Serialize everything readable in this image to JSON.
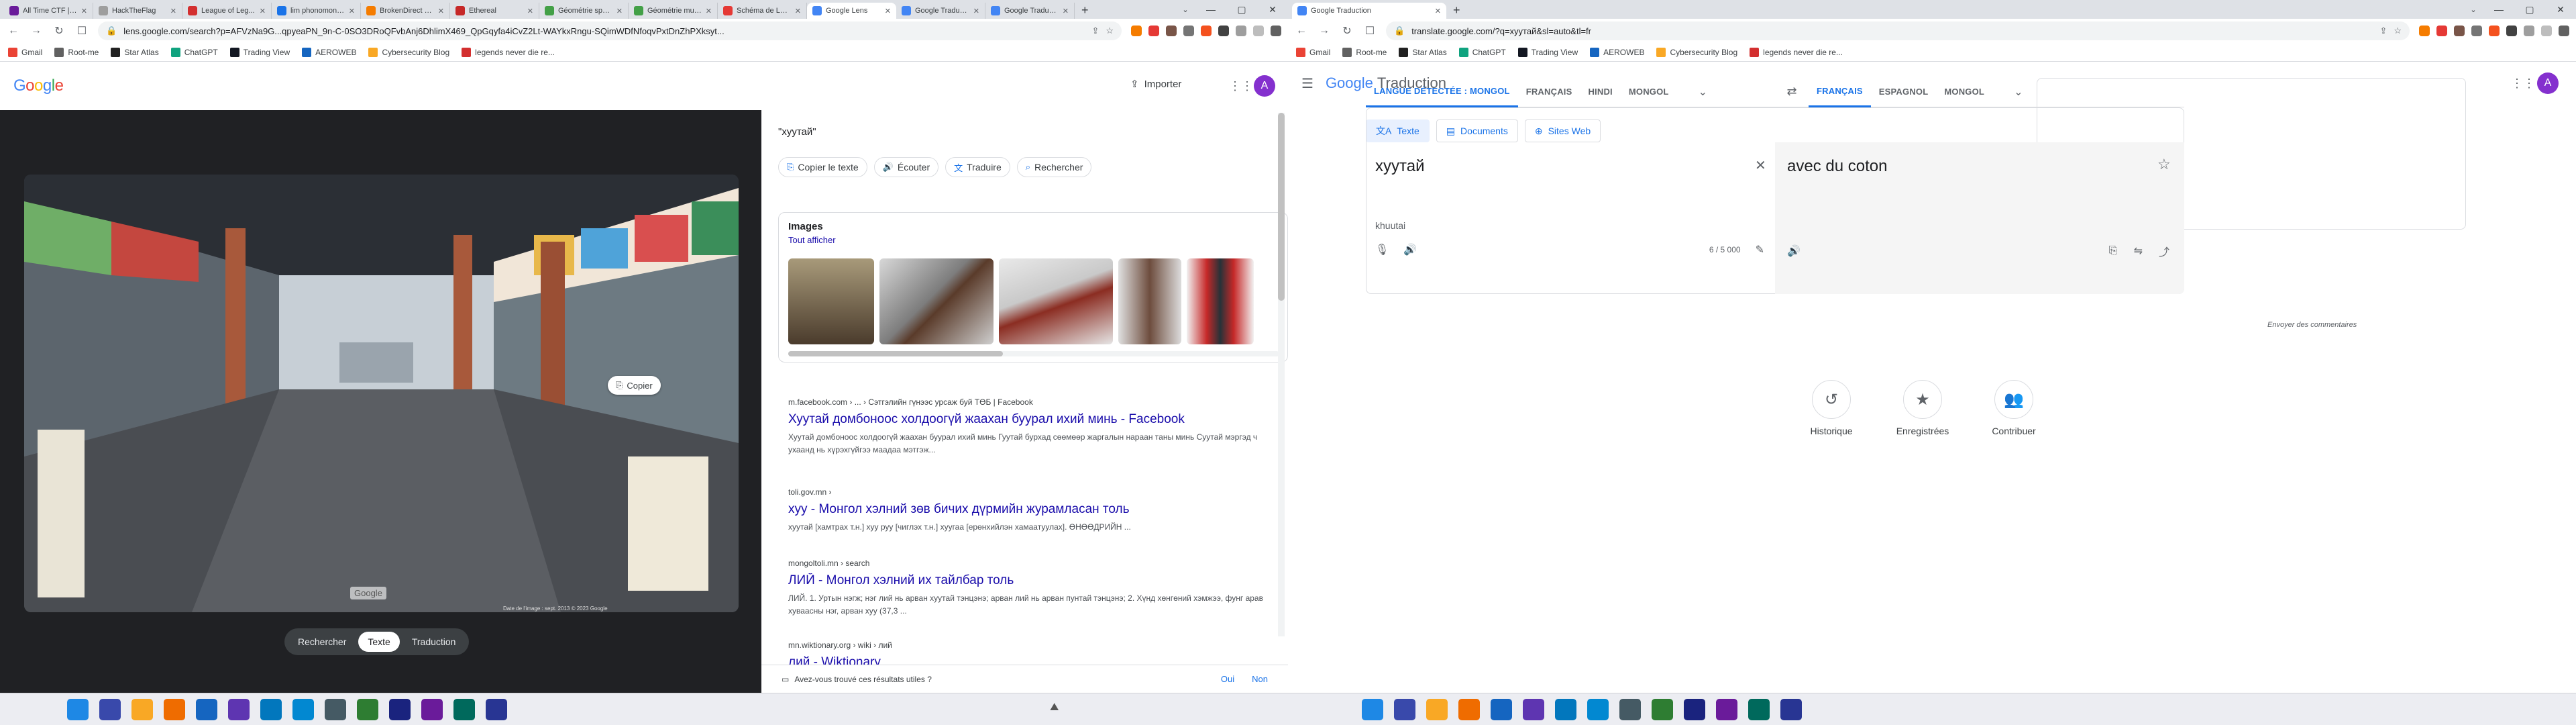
{
  "left": {
    "tabs": [
      {
        "label": "All Time CTF | Arb...",
        "color": "#6a1b9a"
      },
      {
        "label": "HackTheFlag",
        "color": "#9e9e9e"
      },
      {
        "label": "League of Leg...",
        "color": "#d32f2f"
      },
      {
        "label": "lim phonomonian...",
        "color": "#1a73e8"
      },
      {
        "label": "BrokenDirect - Tec...",
        "color": "#f57c00"
      },
      {
        "label": "Ethereal",
        "color": "#c62828"
      },
      {
        "label": "Géométrie sphéri...",
        "color": "#43a047"
      },
      {
        "label": "Géométrie multi...",
        "color": "#43a047"
      },
      {
        "label": "Schéma de Lewi...",
        "color": "#e53935"
      },
      {
        "label": "Google Lens",
        "color": "#4285f4",
        "active": true
      },
      {
        "label": "Google Traduction",
        "color": "#4285f4"
      },
      {
        "label": "Google Traduction",
        "color": "#4285f4"
      }
    ],
    "url": "lens.google.com/search?p=AFVzNa9G...qpyeaPN_9n-C-0SO3DRoQFvbAnj6DhlimX469_QpGqyfa4iCvZ2Lt-WAYkxRngu-SQimWDfNfoqvPxtDnZhPXksyt...",
    "bookmarks": [
      {
        "label": "Gmail",
        "color": "#ea4335"
      },
      {
        "label": "Root-me",
        "color": "#616161"
      },
      {
        "label": "Star Atlas",
        "color": "#212121"
      },
      {
        "label": "ChatGPT",
        "color": "#10a37f"
      },
      {
        "label": "Trading View",
        "color": "#131722"
      },
      {
        "label": "AEROWEB",
        "color": "#1565c0"
      },
      {
        "label": "Cybersecurity Blog",
        "color": "#f9a825"
      },
      {
        "label": "legends never die re...",
        "color": "#d32f2f"
      }
    ],
    "logo": "Google",
    "import_label": "Importer",
    "avatar": "A",
    "copier_chip": "Copier",
    "watermark": "Google",
    "photo_credit": "Date de l'image : sept. 2013  © 2023 Google",
    "modes": [
      "Rechercher",
      "Texte",
      "Traduction"
    ],
    "selected_mode": "Texte",
    "query": "\"хуутай\"",
    "chips": [
      {
        "label": "Copier le texte",
        "icon": "copy-icon"
      },
      {
        "label": "Écouter",
        "icon": "speaker-icon"
      },
      {
        "label": "Traduire",
        "icon": "translate-icon"
      },
      {
        "label": "Rechercher",
        "icon": "search-icon"
      }
    ],
    "images_title": "Images",
    "images_all": "Tout afficher",
    "results": [
      {
        "source": "m.facebook.com › ... › Сэтгэлийн гүнээс урсаж буй ТӨБ | Facebook",
        "title": "Хуутай домбоноос холдоогүй жаахан буурал ихий минь - Facebook",
        "snippet": "Хуутай домбоноос холдоогүй жаахан буурал ихий минь Гуутай бурхад сөөмөөр жаргалын нараан таны минь Суутай мэргэд ч ухаанд нь хүрэхгүйгээ маадаа мэтгэж..."
      },
      {
        "source": "toli.gov.mn ›",
        "title": "хуу - Монгол хэлний зөв бичих дүрмийн журамласан толь",
        "snippet": "хуутай [хамтрах т.н.] хуу руу [чиглэх т.н.] хуугаа [ерөнхийлэн хамаатуулах]. ӨНӨӨДРИЙН ..."
      },
      {
        "source": "mongoltoli.mn › search",
        "title": "ЛИЙ - Монгол хэлний их тайлбар толь",
        "snippet": "ЛИЙ. 1. Уртын нэгж; нэг лий нь арван хуутай тэнцэнэ; арван лий нь арван пунтай тэнцэнэ; 2. Хүнд хөнгөний хэмжээ, фунг арав хуваасны нэг, арван хуу (37,3 ..."
      },
      {
        "source": "mn.wiktionary.org › wiki › лий",
        "title": "лий - Wiktionary",
        "snippet": ""
      }
    ],
    "feedback_q": "Avez-vous trouvé ces résultats utiles ?",
    "yes": "Oui",
    "no": "Non"
  },
  "right": {
    "tab": "Google Traduction",
    "url": "translate.google.com/?q=хуутай&sl=auto&tl=fr",
    "bookmarks": [
      {
        "label": "Gmail",
        "color": "#ea4335"
      },
      {
        "label": "Root-me",
        "color": "#616161"
      },
      {
        "label": "Star Atlas",
        "color": "#212121"
      },
      {
        "label": "ChatGPT",
        "color": "#10a37f"
      },
      {
        "label": "Trading View",
        "color": "#131722"
      },
      {
        "label": "AEROWEB",
        "color": "#1565c0"
      },
      {
        "label": "Cybersecurity Blog",
        "color": "#f9a825"
      },
      {
        "label": "legends never die re...",
        "color": "#d32f2f"
      }
    ],
    "logo_google": "Google",
    "logo_product": "Traduction",
    "avatar": "A",
    "modes": [
      "Texte",
      "Documents",
      "Sites Web"
    ],
    "src_langs": [
      "LANGUE DÉTECTÉE : MONGOL",
      "FRANÇAIS",
      "HINDI",
      "MONGOL"
    ],
    "tgt_langs": [
      "FRANÇAIS",
      "ESPAGNOL",
      "MONGOL"
    ],
    "source_text": "хуутай",
    "transliteration": "khuutai",
    "char_count": "6 / 5 000",
    "target_text": "avec du coton",
    "send_feedback": "Envoyer des commentaires",
    "shortcuts": [
      {
        "label": "Historique",
        "icon": "history-icon"
      },
      {
        "label": "Enregistrées",
        "icon": "star-icon"
      },
      {
        "label": "Contribuer",
        "icon": "people-icon"
      }
    ]
  },
  "taskbar_left": [
    "#1e88e5",
    "#3949ab",
    "#f9a825",
    "#ef6c00",
    "#1565c0",
    "#5e35b1",
    "#0277bd",
    "#0288d1",
    "#455a64",
    "#2e7d32",
    "#1a237e",
    "#6a1b9a",
    "#00695c",
    "#283593"
  ],
  "taskbar_right": [
    "#1e88e5",
    "#3949ab",
    "#f9a825",
    "#ef6c00",
    "#1565c0",
    "#5e35b1",
    "#0277bd",
    "#0288d1",
    "#455a64",
    "#2e7d32",
    "#1a237e",
    "#6a1b9a",
    "#00695c",
    "#283593"
  ]
}
